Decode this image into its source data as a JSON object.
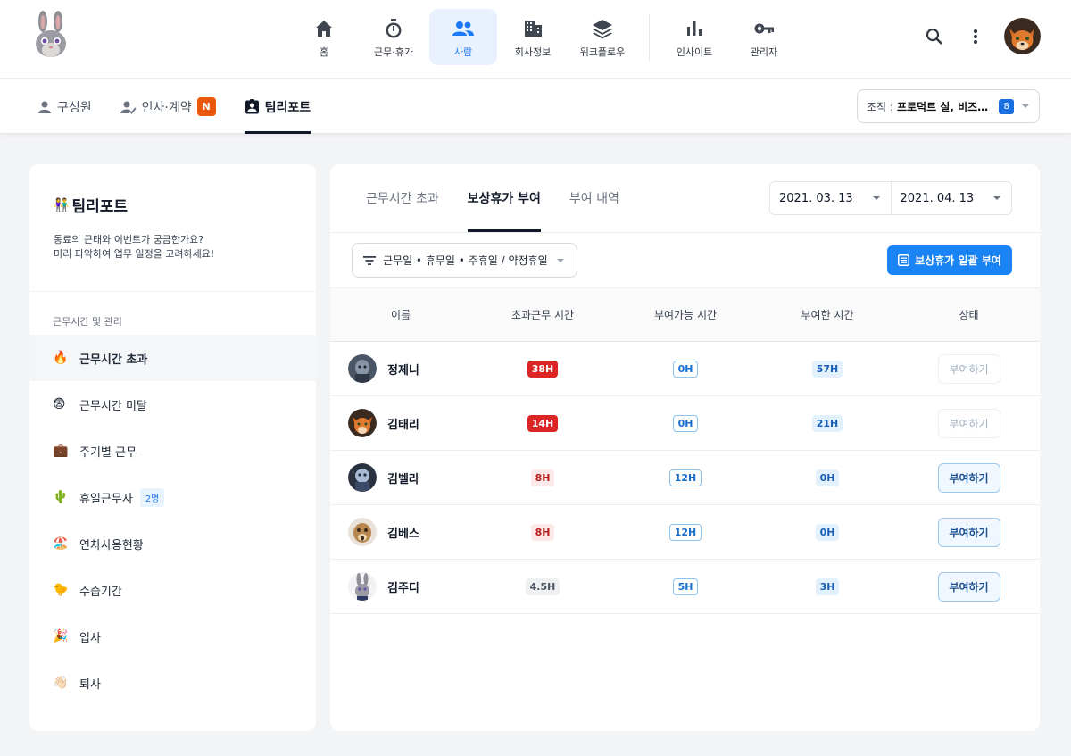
{
  "nav": [
    {
      "label": "홈",
      "icon": "home-icon",
      "active": false
    },
    {
      "label": "근무·휴가",
      "icon": "stopwatch-icon",
      "active": false
    },
    {
      "label": "사람",
      "icon": "people-icon",
      "active": true
    },
    {
      "label": "회사정보",
      "icon": "building-icon",
      "active": false
    },
    {
      "label": "워크플로우",
      "icon": "layers-icon",
      "active": false
    },
    {
      "label": "인사이트",
      "icon": "bar-chart-icon",
      "active": false
    },
    {
      "label": "관리자",
      "icon": "key-icon",
      "active": false
    }
  ],
  "subtabs": [
    {
      "label": "구성원",
      "icon": "person-icon"
    },
    {
      "label": "인사·계약",
      "icon": "person-check-icon",
      "badge": "N"
    },
    {
      "label": "팀리포트",
      "icon": "badge-icon",
      "active": true
    }
  ],
  "org": {
    "label": "조직 :",
    "value": "프로덕트 실, 비즈…",
    "count": "8"
  },
  "sidebar": {
    "title_emoji": "👫",
    "title": "팀리포트",
    "desc1": "동료의 근태와 이벤트가 궁금한가요?",
    "desc2": "미리 파악하여 업무 일정을 고려하세요!",
    "section": "근무시간 및 관리",
    "items": [
      {
        "emoji": "🔥",
        "label": "근무시간 초과",
        "active": true
      },
      {
        "emoji": "😨",
        "label": "근무시간 미달"
      },
      {
        "emoji": "💼",
        "label": "주기별 근무"
      },
      {
        "emoji": "🌵",
        "label": "휴일근무자",
        "badge": "2명"
      },
      {
        "emoji": "🏖️",
        "label": "연차사용현황"
      },
      {
        "emoji": "🐤",
        "label": "수습기간"
      },
      {
        "emoji": "🎉",
        "label": "입사"
      },
      {
        "emoji": "👋🏻",
        "label": "퇴사"
      }
    ]
  },
  "main": {
    "tabs": [
      {
        "label": "근무시간 초과"
      },
      {
        "label": "보상휴가 부여",
        "active": true
      },
      {
        "label": "부여 내역"
      }
    ],
    "date_from": "2021. 03. 13",
    "date_to": "2021. 04. 13",
    "filter": "근무일 • 휴무일 • 주휴일 / 약정휴일",
    "bulk_button": "보상휴가 일괄 부여",
    "columns": [
      "이름",
      "초과근무 시간",
      "부여가능 시간",
      "부여한 시간",
      "상태"
    ],
    "rows": [
      {
        "name": "정제니",
        "over": "38H",
        "avail": "0H",
        "given": "57H",
        "action": "부여하기",
        "enabled": false,
        "over_style": "red"
      },
      {
        "name": "김태리",
        "over": "14H",
        "avail": "0H",
        "given": "21H",
        "action": "부여하기",
        "enabled": false,
        "over_style": "red"
      },
      {
        "name": "김벨라",
        "over": "8H",
        "avail": "12H",
        "given": "0H",
        "action": "부여하기",
        "enabled": true,
        "over_style": "pink"
      },
      {
        "name": "김베스",
        "over": "8H",
        "avail": "12H",
        "given": "0H",
        "action": "부여하기",
        "enabled": true,
        "over_style": "pink"
      },
      {
        "name": "김주디",
        "over": "4.5H",
        "avail": "5H",
        "given": "3H",
        "action": "부여하기",
        "enabled": true,
        "over_style": "gray"
      }
    ]
  }
}
